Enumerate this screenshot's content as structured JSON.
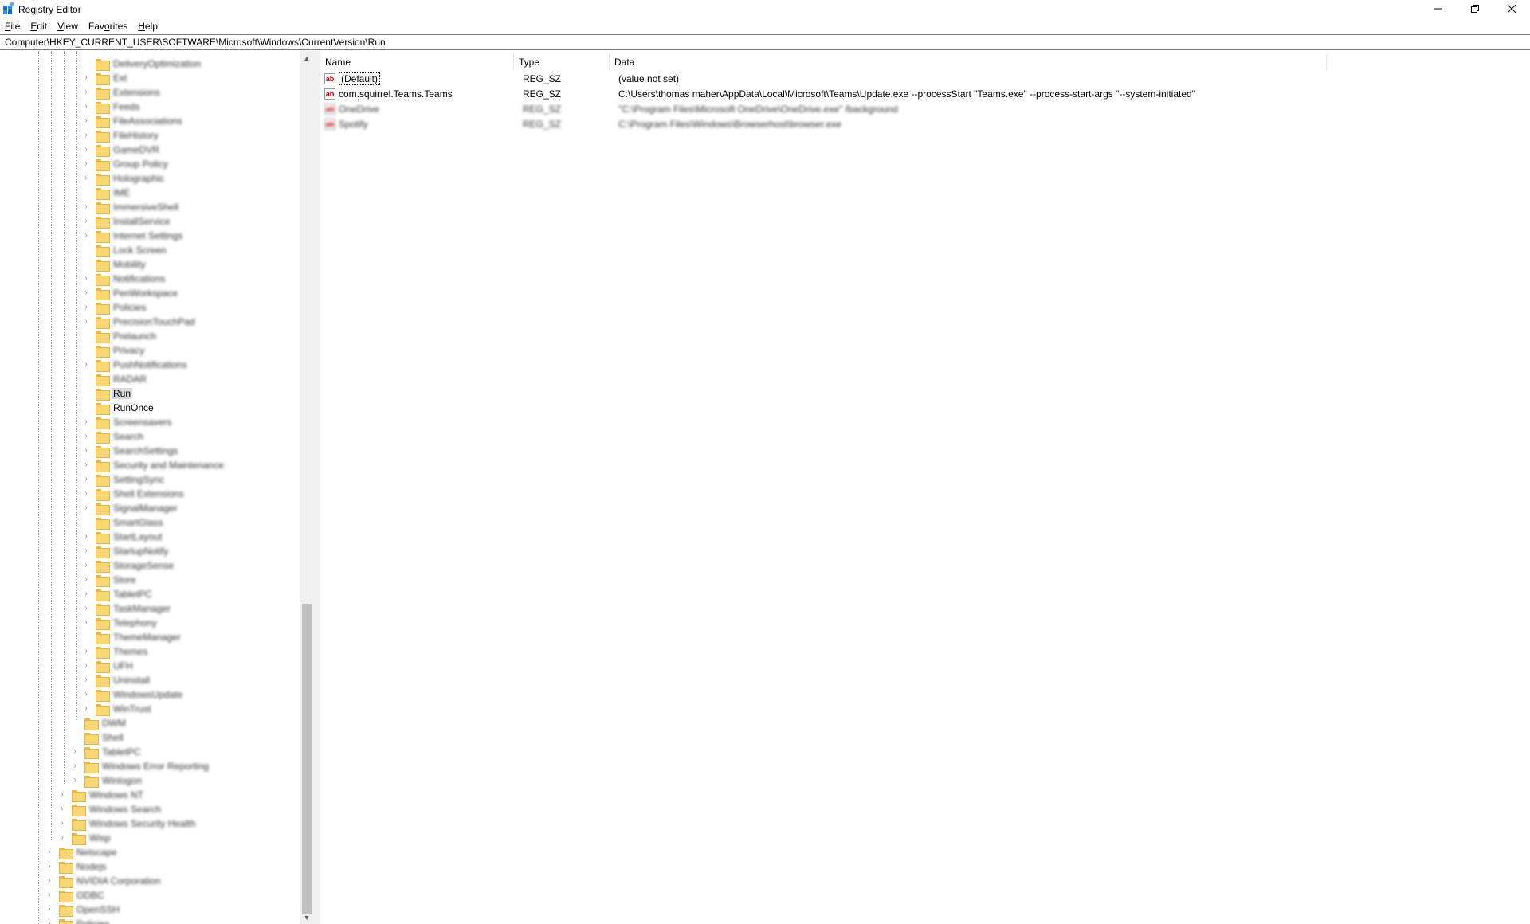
{
  "window": {
    "title": "Registry Editor",
    "buttons": {
      "minimize": "minimize-icon",
      "restore": "restore-icon",
      "close": "close-icon"
    }
  },
  "menu": [
    {
      "label_ul": "F",
      "label_rest": "ile"
    },
    {
      "label_ul": "E",
      "label_rest": "dit"
    },
    {
      "label_ul": "V",
      "label_rest": "iew"
    },
    {
      "label_pre": "Fav",
      "label_ul": "o",
      "label_rest": "rites"
    },
    {
      "label_ul": "H",
      "label_rest": "elp"
    }
  ],
  "address": "Computer\\HKEY_CURRENT_USER\\SOFTWARE\\Microsoft\\Windows\\CurrentVersion\\Run",
  "tree": {
    "items": [
      {
        "label": "DeliveryOptimization",
        "blur": true
      },
      {
        "label": "Ext",
        "blur": true
      },
      {
        "label": "Extensions",
        "blur": true
      },
      {
        "label": "Feeds",
        "blur": true
      },
      {
        "label": "FileAssociations",
        "blur": true
      },
      {
        "label": "FileHistory",
        "blur": true
      },
      {
        "label": "GameDVR",
        "blur": true
      },
      {
        "label": "Group Policy",
        "blur": true
      },
      {
        "label": "Holographic",
        "blur": true
      },
      {
        "label": "IME",
        "blur": true
      },
      {
        "label": "ImmersiveShell",
        "blur": true
      },
      {
        "label": "InstallService",
        "blur": true
      },
      {
        "label": "Internet Settings",
        "blur": true
      },
      {
        "label": "Lock Screen",
        "blur": true
      },
      {
        "label": "Mobility",
        "blur": true
      },
      {
        "label": "Notifications",
        "blur": true
      },
      {
        "label": "PenWorkspace",
        "blur": true
      },
      {
        "label": "Policies",
        "blur": true
      },
      {
        "label": "PrecisionTouchPad",
        "blur": true
      },
      {
        "label": "Prelaunch",
        "blur": true
      },
      {
        "label": "Privacy",
        "blur": true
      },
      {
        "label": "PushNotifications",
        "blur": true
      },
      {
        "label": "RADAR",
        "blur": true
      },
      {
        "label": "Run",
        "blur": false,
        "selected": true
      },
      {
        "label": "RunOnce",
        "blur": false
      },
      {
        "label": "Screensavers",
        "blur": true
      },
      {
        "label": "Search",
        "blur": true
      },
      {
        "label": "SearchSettings",
        "blur": true
      },
      {
        "label": "Security and Maintenance",
        "blur": true
      },
      {
        "label": "SettingSync",
        "blur": true
      },
      {
        "label": "Shell Extensions",
        "blur": true
      },
      {
        "label": "SignalManager",
        "blur": true
      },
      {
        "label": "SmartGlass",
        "blur": true
      },
      {
        "label": "StartLayout",
        "blur": true
      },
      {
        "label": "StartupNotify",
        "blur": true
      },
      {
        "label": "StorageSense",
        "blur": true
      },
      {
        "label": "Store",
        "blur": true
      },
      {
        "label": "TabletPC",
        "blur": true
      },
      {
        "label": "TaskManager",
        "blur": true
      },
      {
        "label": "Telephony",
        "blur": true
      },
      {
        "label": "ThemeManager",
        "blur": true
      },
      {
        "label": "Themes",
        "blur": true
      },
      {
        "label": "UFH",
        "blur": true
      },
      {
        "label": "Uninstall",
        "blur": true
      },
      {
        "label": "WindowsUpdate",
        "blur": true
      },
      {
        "label": "WinTrust",
        "blur": true
      },
      {
        "label": "DWM",
        "blur": true
      },
      {
        "label": "Shell",
        "blur": true
      },
      {
        "label": "TabletPC",
        "blur": true
      },
      {
        "label": "Windows Error Reporting",
        "blur": true
      },
      {
        "label": "Winlogon",
        "blur": true
      },
      {
        "label": "Windows NT",
        "blur": true
      },
      {
        "label": "Windows Search",
        "blur": true
      },
      {
        "label": "Windows Security Health",
        "blur": true
      },
      {
        "label": "Wisp",
        "blur": true
      },
      {
        "label": "Netscape",
        "blur": true
      },
      {
        "label": "Nodejs",
        "blur": true
      },
      {
        "label": "NVIDIA Corporation",
        "blur": true
      },
      {
        "label": "ODBC",
        "blur": true
      },
      {
        "label": "OpenSSH",
        "blur": true
      },
      {
        "label": "Policies",
        "blur": true
      }
    ]
  },
  "list": {
    "columns": {
      "name": "Name",
      "type": "Type",
      "data": "Data"
    },
    "rows": [
      {
        "name": "(Default)",
        "type": "REG_SZ",
        "data": "(value not set)",
        "blur": false,
        "focused": true
      },
      {
        "name": "com.squirrel.Teams.Teams",
        "type": "REG_SZ",
        "data": "C:\\Users\\thomas maher\\AppData\\Local\\Microsoft\\Teams\\Update.exe --processStart \"Teams.exe\" --process-start-args \"--system-initiated\"",
        "blur": false
      },
      {
        "name": "OneDrive",
        "type": "REG_SZ",
        "data": "\"C:\\Program Files\\Microsoft OneDrive\\OneDrive.exe\" /background",
        "blur": true
      },
      {
        "name": "Spotify",
        "type": "REG_SZ",
        "data": "C:\\Program Files\\Windows\\Browserhost\\browser.exe",
        "blur": true
      }
    ]
  }
}
